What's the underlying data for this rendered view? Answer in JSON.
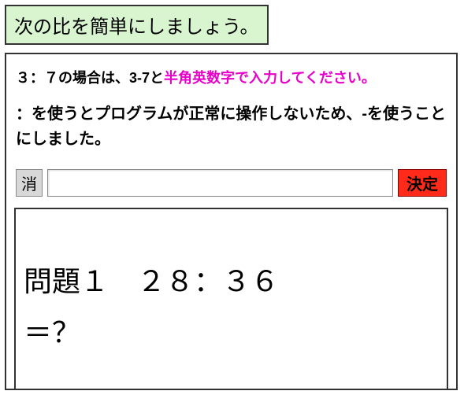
{
  "title": "次の比を簡単にしましょう。",
  "instruction": {
    "part1_black": "３：７の場合は、3-7と",
    "part1_magenta": "半角英数字で入力してください。",
    "part2": "：を使うとプログラムが正常に操作しないため、-を使うことにしました。"
  },
  "controls": {
    "clear_label": "消",
    "submit_label": "決定",
    "input_value": ""
  },
  "problem": {
    "line1": "問題１　２８：３６",
    "line2": "＝？"
  }
}
